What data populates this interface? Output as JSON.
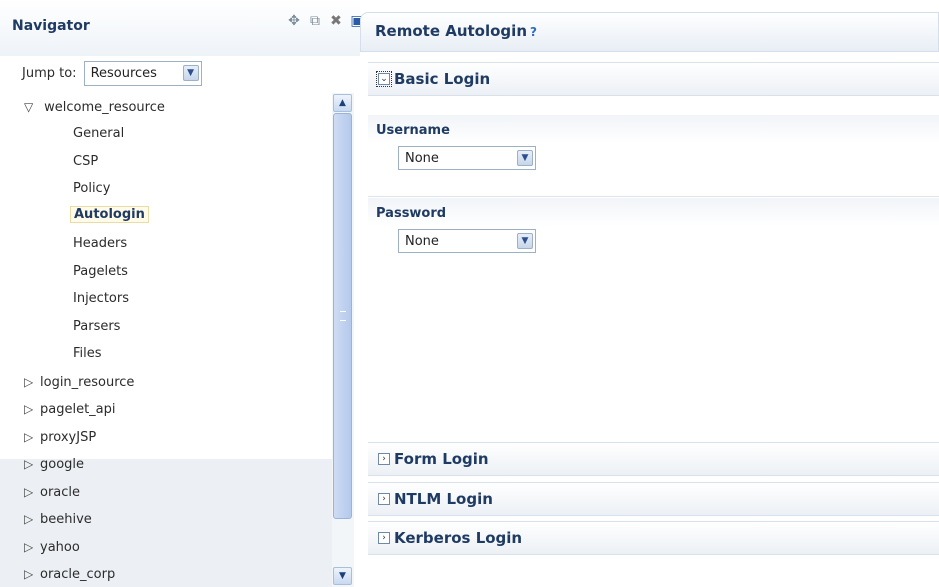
{
  "navigator": {
    "title": "Navigator",
    "toolbar_icons": [
      "add-icon",
      "copy-icon",
      "delete-icon",
      "save-icon"
    ],
    "jump_label": "Jump to:",
    "jump_value": "Resources",
    "tree": {
      "root": "welcome_resource",
      "children": [
        "General",
        "CSP",
        "Policy",
        "Autologin",
        "Headers",
        "Pagelets",
        "Injectors",
        "Parsers",
        "Files"
      ],
      "selected": "Autologin",
      "siblings": [
        "login_resource",
        "pagelet_api",
        "proxyJSP",
        "google",
        "oracle",
        "beehive",
        "yahoo",
        "oracle_corp"
      ]
    }
  },
  "panel": {
    "title": "Remote Autologin",
    "help": "?",
    "sections": {
      "basic": "Basic Login",
      "form": "Form Login",
      "ntlm": "NTLM Login",
      "kerberos": "Kerberos Login"
    },
    "username_label": "Username",
    "username_value": "None",
    "password_label": "Password",
    "password_value": "None"
  },
  "colors": {
    "accent": "#1f3b63",
    "selection_bg": "#fffbe8",
    "scroll": "#b4c9ec"
  }
}
